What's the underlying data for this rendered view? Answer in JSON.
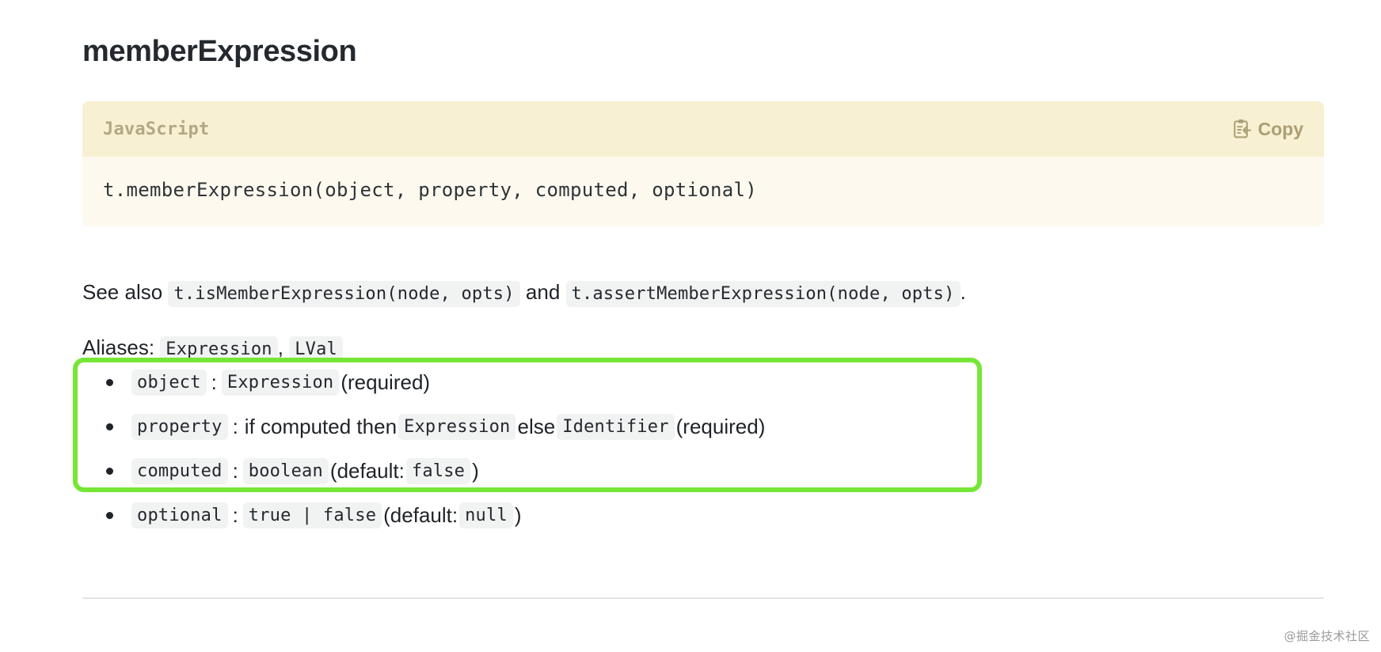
{
  "page": {
    "title": "memberExpression"
  },
  "codeblock": {
    "language": "JavaScript",
    "copy_label": "Copy",
    "copy_icon": "clipboard-copy-icon",
    "code": "t.memberExpression(object, property, computed, optional)",
    "header_bg": "#f7f0d2",
    "body_bg": "#fdf9ef",
    "lang_color": "#b1a884"
  },
  "see_also": {
    "prefix": "See also",
    "first_code": "t.isMemberExpression(node, opts)",
    "conjunction": "and",
    "second_code": "t.assertMemberExpression(node, opts)",
    "suffix": "."
  },
  "aliases": {
    "label": "Aliases:",
    "items": [
      "Expression",
      "LVal"
    ],
    "separator": ","
  },
  "arguments": [
    {
      "name": "object",
      "colon": ":",
      "type": "Expression",
      "note": "(required)"
    },
    {
      "name": "property",
      "colon": ":",
      "condition_prefix": "if computed then",
      "type": "Expression",
      "condition_else": "else",
      "type_alt": "Identifier",
      "note": "(required)"
    },
    {
      "name": "computed",
      "colon": ":",
      "type": "boolean",
      "default_prefix": "(default:",
      "default_value": "false",
      "default_suffix": ")"
    },
    {
      "name": "optional",
      "colon": ":",
      "type": "true | false",
      "default_prefix": "(default:",
      "default_value": "null",
      "default_suffix": ")"
    }
  ],
  "annotation": {
    "color": "#76e636",
    "name": "green-highlight-box"
  },
  "watermark": {
    "text": "@掘金技术社区"
  }
}
